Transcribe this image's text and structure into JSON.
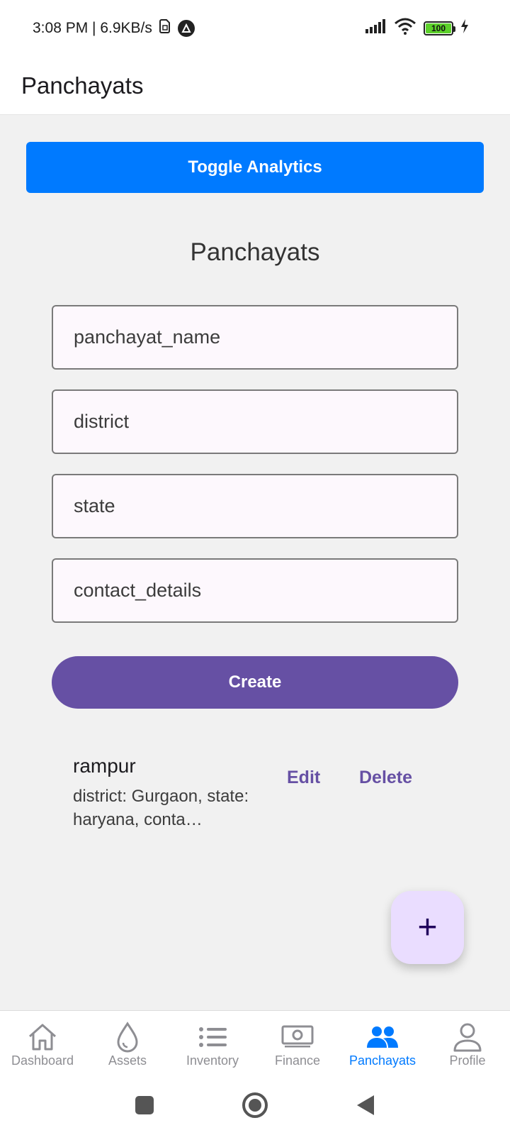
{
  "status_bar": {
    "time_speed": "3:08 PM | 6.9KB/s",
    "battery_level": "100",
    "icons": [
      "sim-icon",
      "app-notification-icon",
      "signal-icon",
      "wifi-icon",
      "battery-icon",
      "charging-icon"
    ]
  },
  "header": {
    "title": "Panchayats"
  },
  "toggle_button": {
    "label": "Toggle Analytics",
    "color": "#007aff"
  },
  "section_title": "Panchayats",
  "form": {
    "fields": [
      {
        "placeholder": "panchayat_name"
      },
      {
        "placeholder": "district"
      },
      {
        "placeholder": "state"
      },
      {
        "placeholder": "contact_details"
      }
    ],
    "create_label": "Create",
    "create_color": "#6650a4"
  },
  "list": {
    "items": [
      {
        "name": "rampur",
        "details": "district: Gurgaon, state: haryana, conta…",
        "edit_label": "Edit",
        "delete_label": "Delete"
      }
    ]
  },
  "fab": {
    "icon": "plus-icon",
    "glyph": "+"
  },
  "bottom_nav": {
    "items": [
      {
        "label": "Dashboard",
        "icon": "home-icon",
        "active": false
      },
      {
        "label": "Assets",
        "icon": "water-drop-icon",
        "active": false
      },
      {
        "label": "Inventory",
        "icon": "list-icon",
        "active": false
      },
      {
        "label": "Finance",
        "icon": "money-icon",
        "active": false
      },
      {
        "label": "Panchayats",
        "icon": "people-icon",
        "active": true
      },
      {
        "label": "Profile",
        "icon": "person-icon",
        "active": false
      }
    ],
    "active_color": "#007aff"
  },
  "system_nav": {
    "icons": [
      "recents-icon",
      "home-circle-icon",
      "back-icon"
    ]
  }
}
